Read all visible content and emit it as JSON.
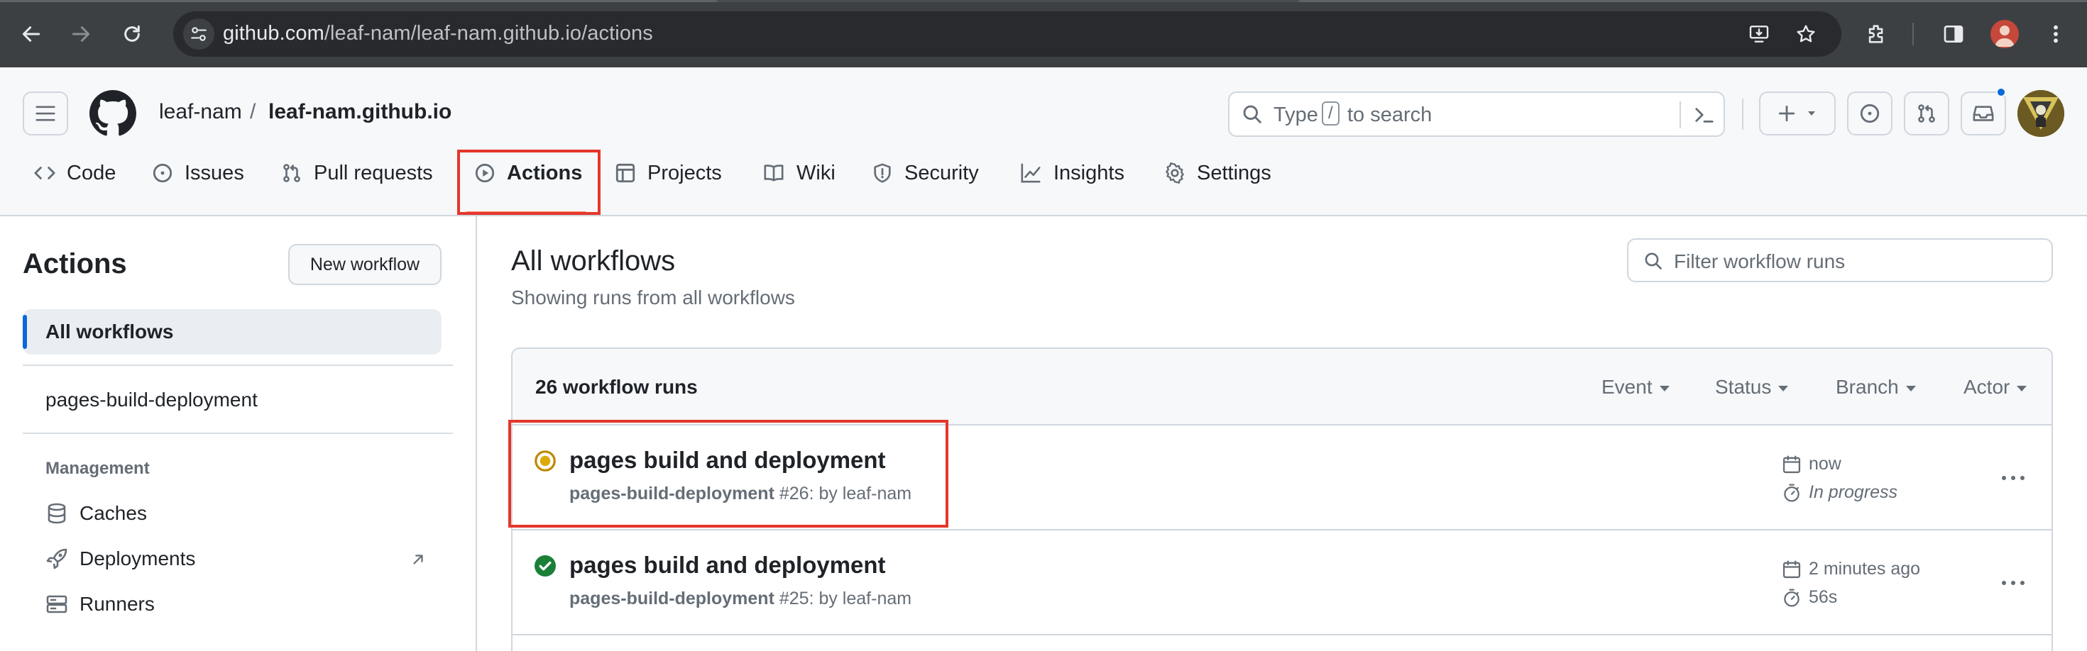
{
  "browser": {
    "url_host": "github.com",
    "url_path": "/leaf-nam/leaf-nam.github.io/actions",
    "icons": [
      "back-icon",
      "forward-icon",
      "reload-icon",
      "site-info-icon",
      "install-app-icon",
      "bookmark-star-icon",
      "extensions-icon",
      "side-panel-icon",
      "profile-avatar",
      "chrome-menu-icon"
    ]
  },
  "header": {
    "owner": "leaf-nam",
    "separator": "/",
    "repo": "leaf-nam.github.io",
    "search_prefix": "Type",
    "search_key": "/",
    "search_suffix": "to search",
    "tabs": [
      {
        "label": "Code",
        "icon": "code-icon"
      },
      {
        "label": "Issues",
        "icon": "issue-opened-icon"
      },
      {
        "label": "Pull requests",
        "icon": "git-pull-request-icon"
      },
      {
        "label": "Actions",
        "icon": "play-icon",
        "selected": true
      },
      {
        "label": "Projects",
        "icon": "table-icon"
      },
      {
        "label": "Wiki",
        "icon": "book-icon"
      },
      {
        "label": "Security",
        "icon": "shield-icon"
      },
      {
        "label": "Insights",
        "icon": "graph-icon"
      },
      {
        "label": "Settings",
        "icon": "gear-icon"
      }
    ]
  },
  "sidebar": {
    "title": "Actions",
    "new_workflow": "New workflow",
    "all_workflows": "All workflows",
    "workflows": [
      "pages-build-deployment"
    ],
    "management_heading": "Management",
    "management": [
      {
        "label": "Caches",
        "icon": "database-icon"
      },
      {
        "label": "Deployments",
        "icon": "rocket-icon",
        "external": true
      },
      {
        "label": "Runners",
        "icon": "server-icon"
      }
    ]
  },
  "main": {
    "title": "All workflows",
    "subtitle": "Showing runs from all workflows",
    "filter_placeholder": "Filter workflow runs",
    "runs_count": "26 workflow runs",
    "filters": [
      "Event",
      "Status",
      "Branch",
      "Actor"
    ],
    "runs": [
      {
        "title": "pages build and deployment",
        "workflow": "pages-build-deployment",
        "number_by": "#26: by leaf-nam",
        "status": "in_progress",
        "status_color": "#bf8700",
        "when": "now",
        "duration": "In progress"
      },
      {
        "title": "pages build and deployment",
        "workflow": "pages-build-deployment",
        "number_by": "#25: by leaf-nam",
        "status": "success",
        "status_color": "#1a7f37",
        "when": "2 minutes ago",
        "duration": "56s"
      }
    ]
  },
  "colors": {
    "highlight": "#e5372b",
    "accent": "#0969da",
    "tab_underline": "#fd8c73"
  }
}
